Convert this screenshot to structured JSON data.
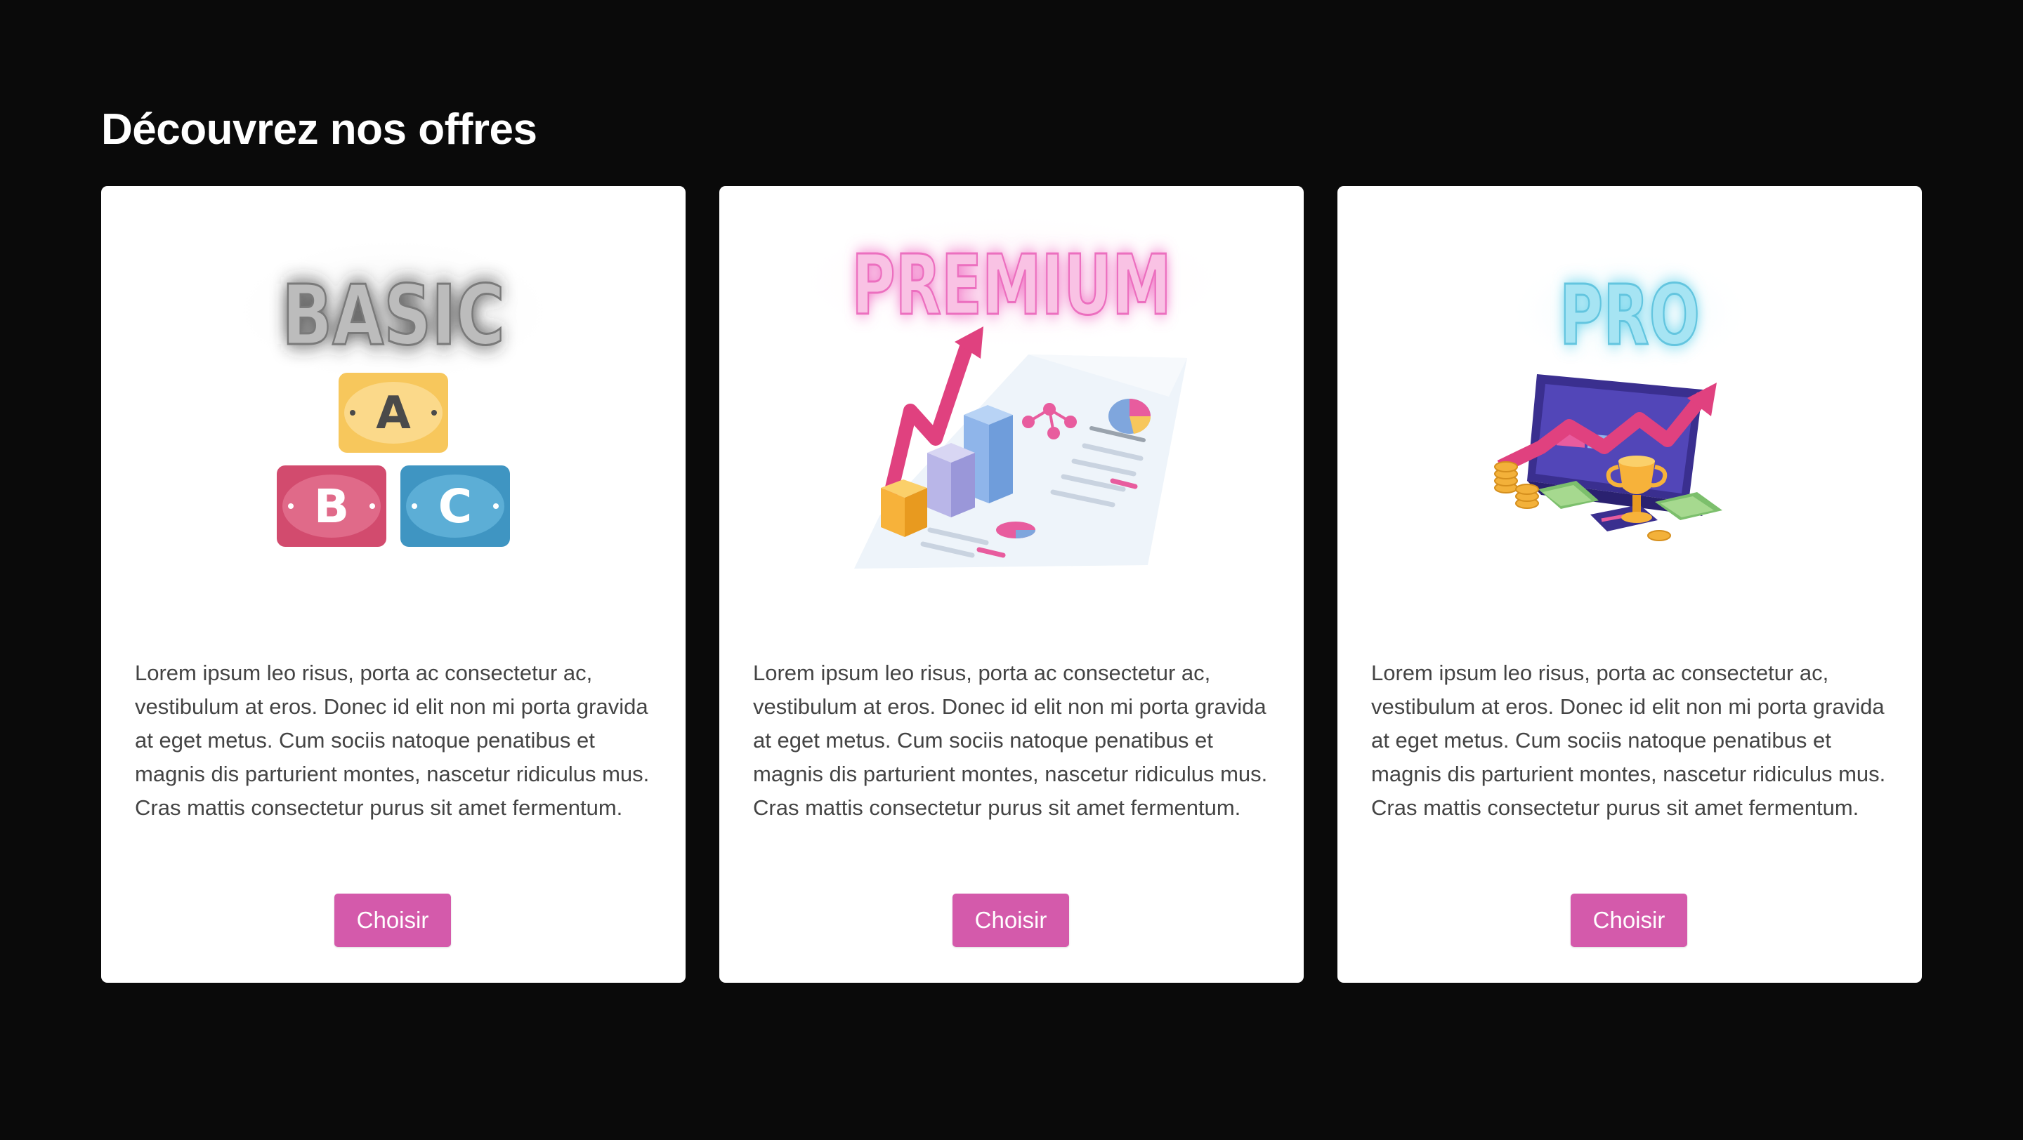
{
  "page": {
    "title": "Découvrez nos offres"
  },
  "colors": {
    "background": "#0a0a0a",
    "card": "#ffffff",
    "button": "#d45aab",
    "text": "#444444"
  },
  "cards": [
    {
      "plan": "BASIC",
      "illustration": "abc-blocks-icon",
      "blocks": [
        "A",
        "B",
        "C"
      ],
      "description": "Lorem ipsum leo risus, porta ac consectetur ac, vestibulum at eros. Donec id elit non mi porta gravida at eget metus. Cum sociis natoque penatibus et magnis dis parturient montes, nascetur ridiculus mus. Cras mattis consectetur purus sit amet fermentum.",
      "button": "Choisir"
    },
    {
      "plan": "PREMIUM",
      "illustration": "analytics-report-icon",
      "description": "Lorem ipsum leo risus, porta ac consectetur ac, vestibulum at eros. Donec id elit non mi porta gravida at eget metus. Cum sociis natoque penatibus et magnis dis parturient montes, nascetur ridiculus mus. Cras mattis consectetur purus sit amet fermentum.",
      "button": "Choisir"
    },
    {
      "plan": "PRO",
      "illustration": "growth-monitor-trophy-icon",
      "description": "Lorem ipsum leo risus, porta ac consectetur ac, vestibulum at eros. Donec id elit non mi porta gravida at eget metus. Cum sociis natoque penatibus et magnis dis parturient montes, nascetur ridiculus mus. Cras mattis consectetur purus sit amet fermentum.",
      "button": "Choisir"
    }
  ]
}
